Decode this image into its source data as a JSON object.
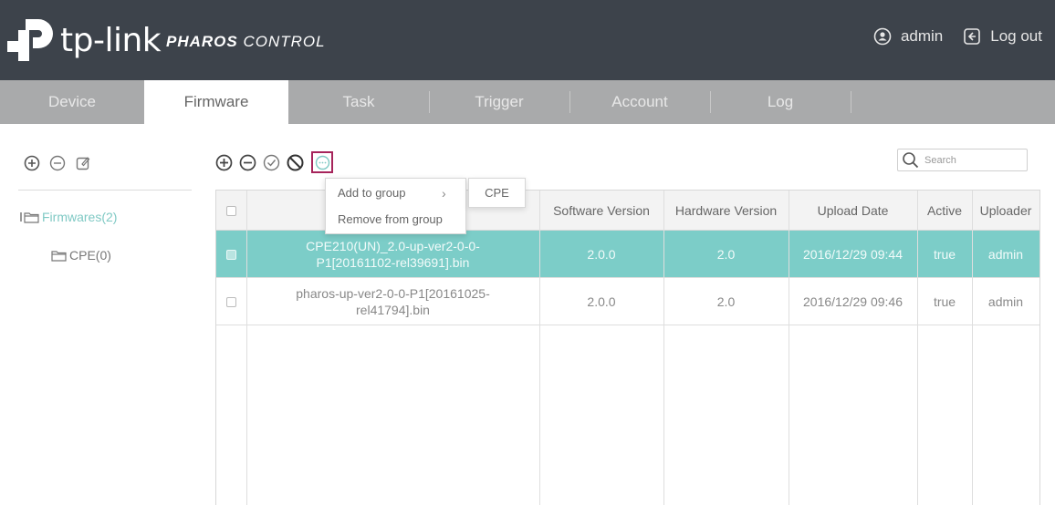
{
  "header": {
    "logo_text": "tp-link",
    "brand_bold": "PHAROS",
    "brand_light": " CONTROL",
    "user_label": "admin",
    "logout_label": "Log out"
  },
  "tabs": [
    {
      "label": "Device",
      "active": false
    },
    {
      "label": "Firmware",
      "active": true
    },
    {
      "label": "Task",
      "active": false
    },
    {
      "label": "Trigger",
      "active": false
    },
    {
      "label": "Account",
      "active": false
    },
    {
      "label": "Log",
      "active": false
    }
  ],
  "tree": {
    "root_label": "Firmwares(2)",
    "child_label": "CPE(0)"
  },
  "search": {
    "placeholder": "Search"
  },
  "table": {
    "columns": [
      "Software Version",
      "Hardware Version",
      "Upload Date",
      "Active",
      "Uploader"
    ],
    "rows": [
      {
        "name_line1": "CPE210(UN)_2.0-up-ver2-0-0-",
        "name_line2": "P1[20161102-rel39691].bin",
        "software_version": "2.0.0",
        "hardware_version": "2.0",
        "upload_date": "2016/12/29 09:44",
        "active": "true",
        "uploader": "admin",
        "selected": true
      },
      {
        "name_line1": "pharos-up-ver2-0-0-P1[20161025-",
        "name_line2": "rel41794].bin",
        "software_version": "2.0.0",
        "hardware_version": "2.0",
        "upload_date": "2016/12/29 09:46",
        "active": "true",
        "uploader": "admin",
        "selected": false
      }
    ]
  },
  "context_menu": {
    "add_to_group": "Add to group",
    "remove_from_group": "Remove from group",
    "submenu_item": "CPE"
  },
  "colors": {
    "header_bg": "#3d434b",
    "tabbar_bg": "#a9aaab",
    "selected_row": "#7ccdc8",
    "highlight_border": "#a6245b",
    "logo_red": "#4ac1e0"
  }
}
